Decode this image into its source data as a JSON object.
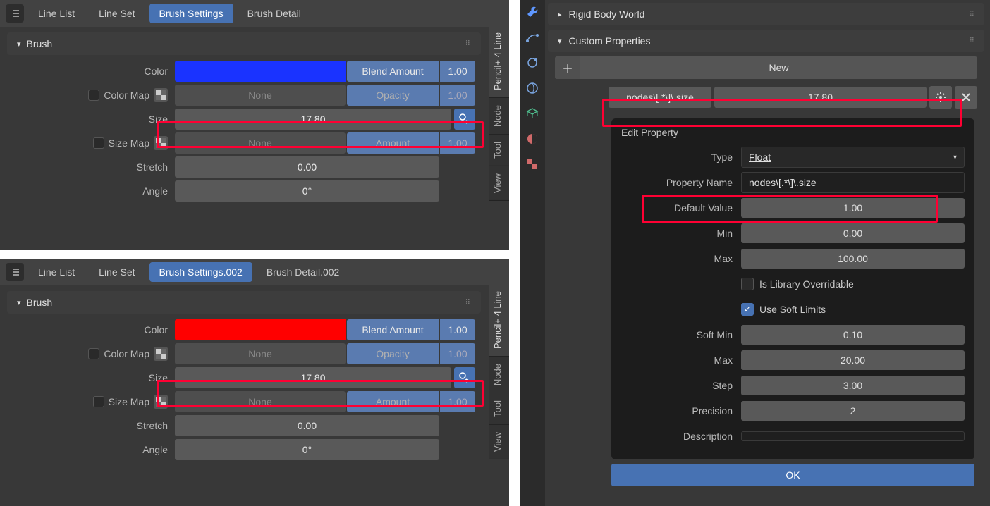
{
  "left_top": {
    "tabs": [
      "Line List",
      "Line Set",
      "Brush Settings",
      "Brush Detail"
    ],
    "active_tab": 2,
    "section": "Brush",
    "color": "#1a33ff",
    "rows": {
      "color_label": "Color",
      "blend_amount_label": "Blend Amount",
      "blend_amount_val": "1.00",
      "color_map_label": "Color Map",
      "none1": "None",
      "opacity_label": "Opacity",
      "opacity_val": "1.00",
      "size_label": "Size",
      "size_val": "17.80",
      "size_map_label": "Size Map",
      "none2": "None",
      "amount_label": "Amount",
      "amount_val": "1.00",
      "stretch_label": "Stretch",
      "stretch_val": "0.00",
      "angle_label": "Angle",
      "angle_val": "0°"
    },
    "vtabs": [
      "Pencil+ 4 Line",
      "Node",
      "Tool",
      "View"
    ]
  },
  "left_bottom": {
    "tabs": [
      "Line List",
      "Line Set",
      "Brush Settings.002",
      "Brush Detail.002"
    ],
    "active_tab": 2,
    "section": "Brush",
    "color": "#ff0000",
    "rows": {
      "color_label": "Color",
      "blend_amount_label": "Blend Amount",
      "blend_amount_val": "1.00",
      "color_map_label": "Color Map",
      "none1": "None",
      "opacity_label": "Opacity",
      "opacity_val": "1.00",
      "size_label": "Size",
      "size_val": "17.80",
      "size_map_label": "Size Map",
      "none2": "None",
      "amount_label": "Amount",
      "amount_val": "1.00",
      "stretch_label": "Stretch",
      "stretch_val": "0.00",
      "angle_label": "Angle",
      "angle_val": "0°"
    },
    "vtabs": [
      "Pencil+ 4 Line",
      "Node",
      "Tool",
      "View"
    ]
  },
  "right": {
    "section1": "Rigid Body World",
    "section2": "Custom Properties",
    "new_btn": "New",
    "prop_name": "nodes\\[.*\\]\\.size",
    "prop_val": "17.80",
    "edit": {
      "title": "Edit Property",
      "type_label": "Type",
      "type_val": "Float",
      "name_label": "Property Name",
      "name_val": "nodes\\[.*\\]\\.size",
      "default_label": "Default Value",
      "default_val": "1.00",
      "min_label": "Min",
      "min_val": "0.00",
      "max_label": "Max",
      "max_val": "100.00",
      "lib_label": "Is Library Overridable",
      "soft_label": "Use Soft Limits",
      "softmin_label": "Soft Min",
      "softmin_val": "0.10",
      "softmax_label": "Max",
      "softmax_val": "20.00",
      "step_label": "Step",
      "step_val": "3.00",
      "prec_label": "Precision",
      "prec_val": "2",
      "desc_label": "Description",
      "desc_val": "",
      "ok": "OK"
    }
  }
}
